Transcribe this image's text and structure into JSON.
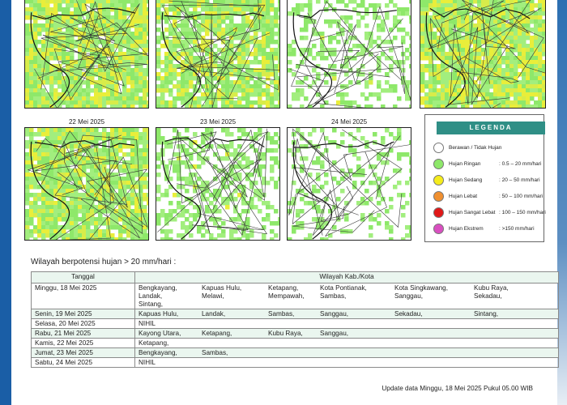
{
  "maps": {
    "row2": [
      {
        "date": "22 Mei 2025"
      },
      {
        "date": "23 Mei 2025"
      },
      {
        "date": "24 Mei 2025"
      }
    ]
  },
  "legend": {
    "title": "LEGENDA",
    "items": [
      {
        "label": "Berawan / Tidak Hujan",
        "range": "",
        "color": "#ffffff"
      },
      {
        "label": "Hujan Ringan",
        "range": ": 0.5 – 20 mm/hari",
        "color": "#8ee86a"
      },
      {
        "label": "Hujan Sedang",
        "range": ": 20 – 50 mm/hari",
        "color": "#f5ec1c"
      },
      {
        "label": "Hujan Lebat",
        "range": ": 50 – 100 mm/hari",
        "color": "#f09030"
      },
      {
        "label": "Hujan Sangat Lebat",
        "range": ": 100 – 150 mm/hari",
        "color": "#e01818"
      },
      {
        "label": "Hujan Ekstrem",
        "range": ": >150 mm/hari",
        "color": "#d94fc0"
      }
    ]
  },
  "table": {
    "heading": "Wilayah berpotensi hujan > 20 mm/hari :",
    "col_tanggal": "Tanggal",
    "col_wilayah": "Wilayah Kab./Kota",
    "rows": [
      {
        "tanggal": "Minggu, 18 Mei 2025",
        "wilayah": [
          "Bengkayang,",
          "Kapuas Hulu,",
          "Ketapang,",
          "Kota Pontianak,",
          "Kota Singkawang,",
          "Kubu Raya,",
          "Landak,",
          "Melawi,",
          "Mempawah,",
          "Sambas,",
          "Sanggau,",
          "Sekadau,",
          "Sintang,"
        ]
      },
      {
        "tanggal": "Senin, 19 Mei 2025",
        "wilayah": [
          "Kapuas Hulu,",
          "Landak,",
          "Sambas,",
          "Sanggau,",
          "Sekadau,",
          "Sintang,"
        ]
      },
      {
        "tanggal": "Selasa, 20 Mei 2025",
        "wilayah": [
          "NIHIL"
        ]
      },
      {
        "tanggal": "Rabu, 21 Mei 2025",
        "wilayah": [
          "Kayong Utara,",
          "Ketapang,",
          "Kubu Raya,",
          "Sanggau,"
        ]
      },
      {
        "tanggal": "Kamis, 22 Mei 2025",
        "wilayah": [
          "Ketapang,"
        ]
      },
      {
        "tanggal": "Jumat, 23 Mei 2025",
        "wilayah": [
          "Bengkayang,",
          "Sambas,"
        ]
      },
      {
        "tanggal": "Sabtu, 24 Mei 2025",
        "wilayah": [
          "NIHIL"
        ]
      }
    ]
  },
  "footer": "Update data Minggu, 18 Mei 2025 Pukul 05.00 WIB"
}
